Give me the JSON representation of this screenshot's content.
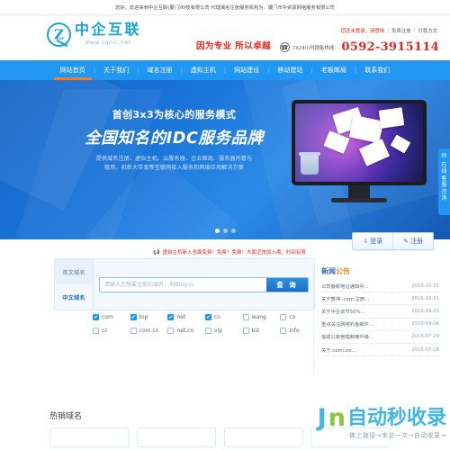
{
  "topbar": {
    "welcome": "您好，欢迎来到中企互联(厦门)科技有限公司 代理域名注册服务机构为：厦门市中资源网络服务有限公司"
  },
  "header": {
    "logo_cn": "中企互联",
    "logo_en": "www.zqnic.net",
    "slogan": "因为专业 所以卓越",
    "links": {
      "not_logged": "您还未登录，请登陆",
      "register": "免费注册",
      "payment": "付款方式",
      "sep": "|"
    },
    "hotline_label": "7X24小时销售热线：",
    "hotline_number": "0592-3915114"
  },
  "nav": {
    "items": [
      {
        "label": "网站首页",
        "active": true
      },
      {
        "label": "关于我们",
        "active": false
      },
      {
        "label": "域名注册",
        "active": false
      },
      {
        "label": "虚拟主机",
        "active": false
      },
      {
        "label": "网站建设",
        "active": false
      },
      {
        "label": "移动建站",
        "active": false
      },
      {
        "label": "老板邮局",
        "active": false
      },
      {
        "label": "联系我们",
        "active": false
      }
    ],
    "separator": "|"
  },
  "hero": {
    "heading1": "首创3x3为核心的服务模式",
    "heading2": "全国知名的IDC服务品牌",
    "sub_line1": "提供域名注册、虚拟主机、云服务器、企业邮局、服务器托管与",
    "sub_line2": "租用，机柜大带宽等互联网接入服务和网络应用解决方案",
    "monitor_brand": "",
    "dots": 3,
    "active_dot": 0
  },
  "side_tab": {
    "icon": "✉",
    "text": "在线客服咨询"
  },
  "account": {
    "login": "登录",
    "login_icon": "⇩",
    "register": "注册",
    "register_icon": "✎"
  },
  "notice": {
    "icon": "📢",
    "text": "虚拟主机新入全面免费！免费！免费！大家近快加入哦，时间有限"
  },
  "search": {
    "tabs": [
      {
        "label": "英文域名",
        "active": false
      },
      {
        "label": "中文域名",
        "active": true
      }
    ],
    "placeholder": "请输入您想要注册的域名，例如zqnic",
    "value": "",
    "button": "查 询"
  },
  "tlds": [
    {
      "label": "com",
      "checked": true
    },
    {
      "label": "top",
      "checked": true
    },
    {
      "label": "net",
      "checked": true
    },
    {
      "label": "cn",
      "checked": true
    },
    {
      "label": "wang",
      "checked": false
    },
    {
      "label": "co",
      "checked": false
    },
    {
      "label": "cc",
      "checked": false
    },
    {
      "label": "com.cn",
      "checked": false
    },
    {
      "label": "net.cn",
      "checked": false
    },
    {
      "label": "vip",
      "checked": false
    },
    {
      "label": "biz",
      "checked": false
    },
    {
      "label": "info",
      "checked": false
    }
  ],
  "news": {
    "title_part1": "新闻",
    "title_part2": "公告",
    "items": [
      {
        "title": "公司搬新地址通知中...",
        "date": "2016-10-31"
      },
      {
        "title": "关于暂停 .com 注册...",
        "date": "2016-10-31"
      },
      {
        "title": "关于中企双节50%...",
        "date": "2016-09-30"
      },
      {
        "title": "重点关注网络钓鱼邮件...",
        "date": "2016-09-06"
      },
      {
        "title": "信戒公有管理制度升级...",
        "date": "2016-07-29"
      },
      {
        "title": "关于.com/.ne...",
        "date": "2016-07-18"
      }
    ]
  },
  "hot": {
    "title": "热销域名",
    "card_count": 4
  },
  "watermark": {
    "letter_j": "J",
    "letter_n": "n",
    "text": "自动秒收录",
    "sub": "做上链接→来访一次→自动收录→"
  },
  "colors": {
    "brand_blue": "#2196f3",
    "logo_blue": "#17a3dc",
    "accent_red": "#e2281e",
    "nav_active": "#f57c20",
    "watermark_blue": "#3fb6e8",
    "watermark_green": "#8cc63f"
  }
}
